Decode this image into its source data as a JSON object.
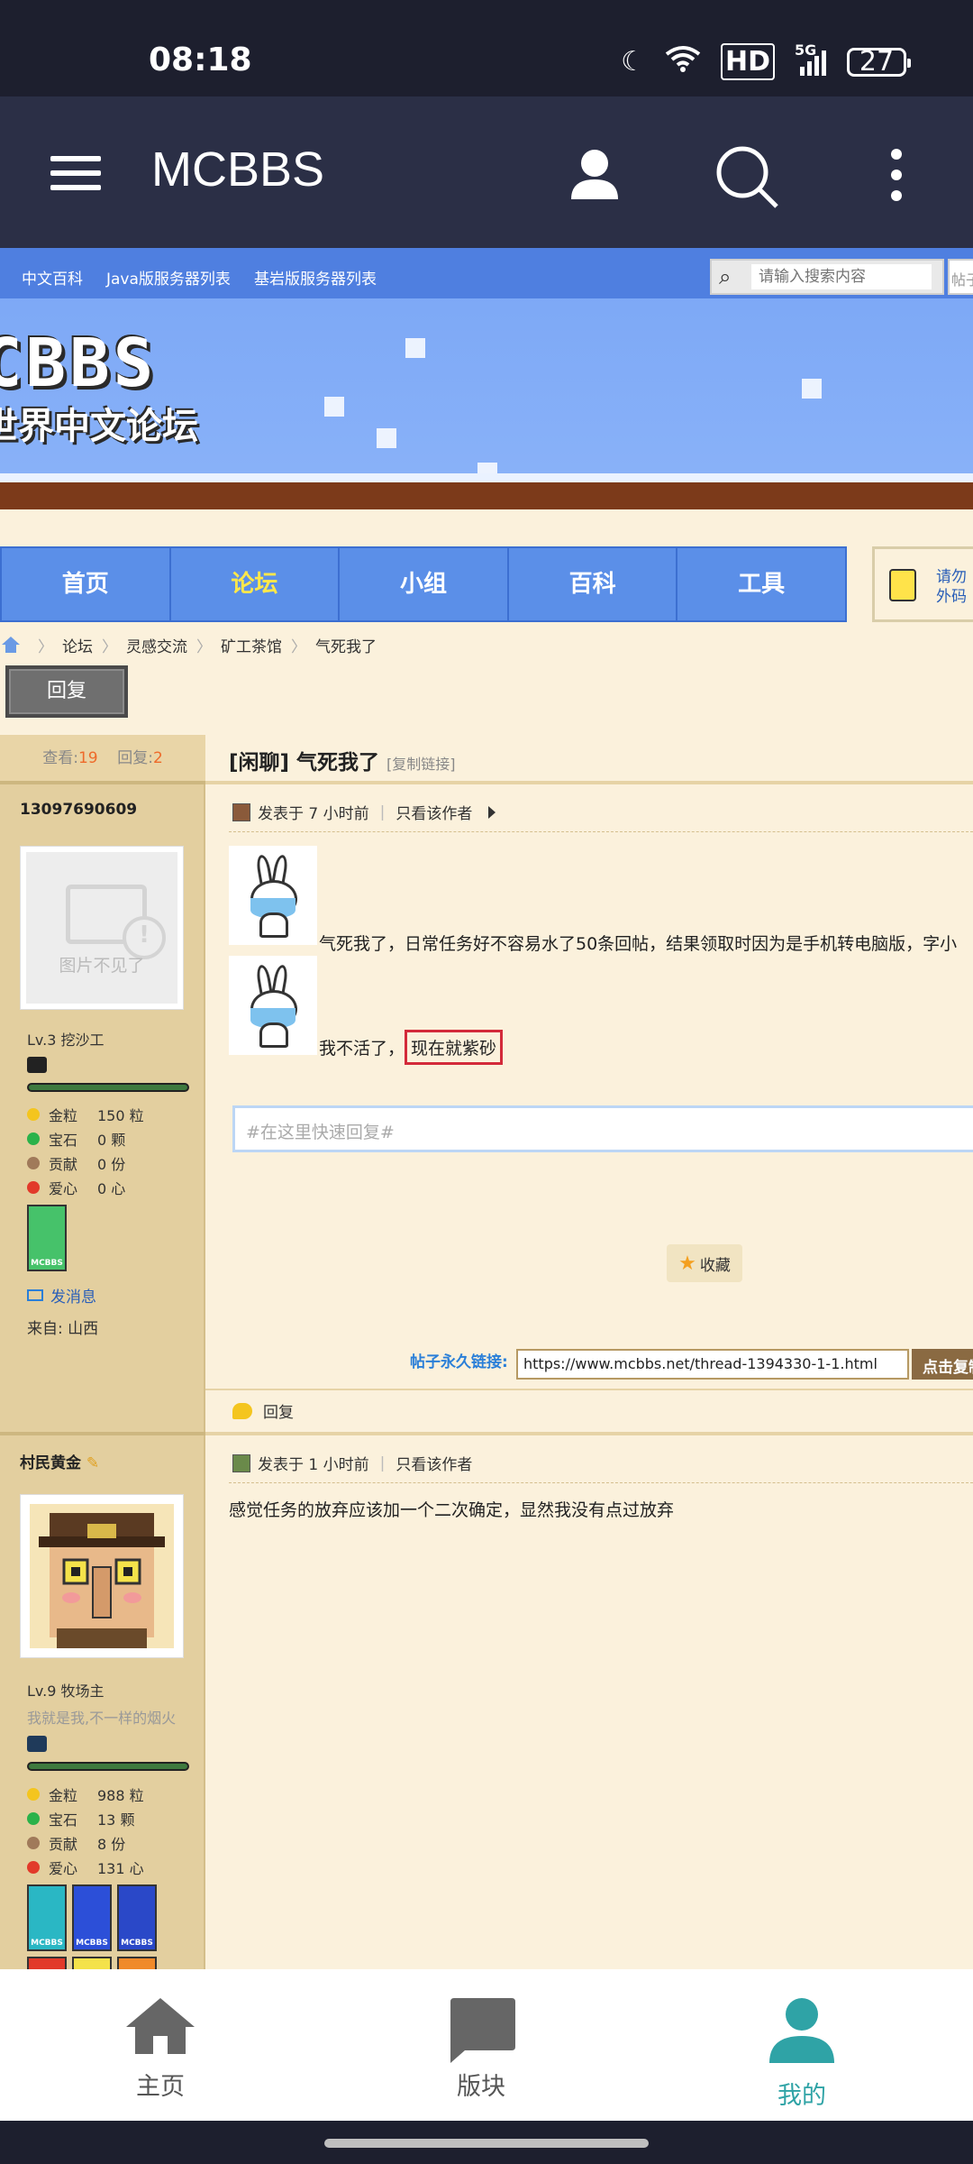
{
  "status": {
    "time": "08:18",
    "network": "5G",
    "hd": "HD",
    "battery": "27"
  },
  "appbar": {
    "title": "MCBBS"
  },
  "banner": {
    "links": [
      "中文百科",
      "Java版服务器列表",
      "基岩版服务器列表"
    ],
    "search_placeholder": "请输入搜索内容",
    "search_scope": "帖子",
    "logo_line1": "CBBS",
    "logo_line2": "世界中文论坛"
  },
  "nav": {
    "items": [
      "首页",
      "论坛",
      "小组",
      "百科",
      "工具"
    ],
    "notice": "请勿外码"
  },
  "breadcrumb": [
    "论坛",
    "灵感交流",
    "矿工茶馆",
    "气死我了"
  ],
  "reply_button": "回复",
  "thread": {
    "views_label": "查看:",
    "views": "19",
    "replies_label": "回复:",
    "replies": "2",
    "title": "[闲聊] 气死我了",
    "copy_link": "[复制链接]"
  },
  "post1": {
    "author": "13097690609",
    "avatar_missing": "图片不见了",
    "level": "Lv.3 挖沙工",
    "stats": [
      {
        "k": "金粒",
        "v": "150 粒",
        "color": "#f4c51e"
      },
      {
        "k": "宝石",
        "v": "0 颗",
        "color": "#2bb24a"
      },
      {
        "k": "贡献",
        "v": "0 份",
        "color": "#a07a5a"
      },
      {
        "k": "爱心",
        "v": "0 心",
        "color": "#e23a2a"
      }
    ],
    "medal_label": "MCBBS",
    "send_message": "发消息",
    "from": "来自:  山西",
    "posted": "发表于 7 小时前",
    "only_author": "只看该作者",
    "line1": "气死我了，日常任务好不容易水了50条回帖，结果领取时因为是手机转电脑版，字小",
    "line2_prefix": "我不活了，",
    "line2_highlight": "现在就紫砂",
    "quick_reply_placeholder": "#在这里快速回复#",
    "favorite": "收藏",
    "permalink_label": "帖子永久链接:",
    "permalink_url": "https://www.mcbbs.net/thread-1394330-1-1.html",
    "copy_button": "点击复制",
    "reply": "回复"
  },
  "post2": {
    "author": "村民黄金",
    "level": "Lv.9 牧场主",
    "signature": "我就是我,不一样的烟火",
    "stats": [
      {
        "k": "金粒",
        "v": "988 粒",
        "color": "#f4c51e"
      },
      {
        "k": "宝石",
        "v": "13 颗",
        "color": "#2bb24a"
      },
      {
        "k": "贡献",
        "v": "8 份",
        "color": "#a07a5a"
      },
      {
        "k": "爱心",
        "v": "131 心",
        "color": "#e23a2a"
      }
    ],
    "medal_label": "MCBBS",
    "posted": "发表于 1 小时前",
    "only_author": "只看该作者",
    "content": "感觉任务的放弃应该加一个二次确定，显然我没有点过放弃"
  },
  "bottomnav": {
    "items": [
      "主页",
      "版块",
      "我的"
    ],
    "active_color": "#2fa3a6"
  }
}
